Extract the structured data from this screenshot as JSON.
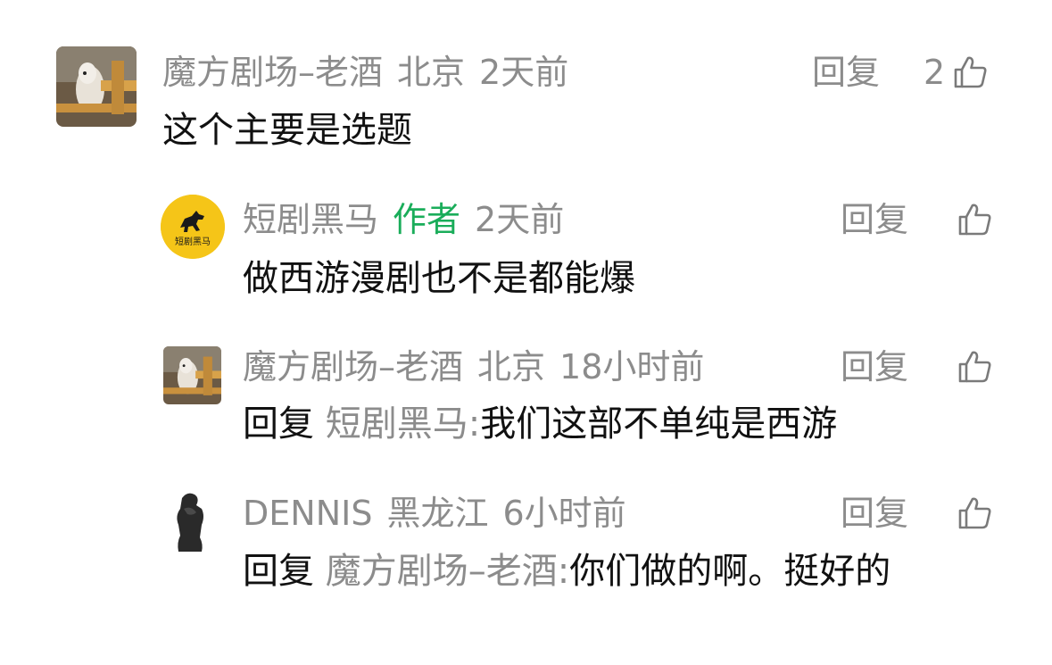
{
  "comments": [
    {
      "username": "魔方剧场–老酒",
      "location": "北京",
      "time": "2天前",
      "text": "这个主要是选题",
      "reply_label": "回复",
      "likes": "2"
    }
  ],
  "replies": [
    {
      "username": "短剧黑马",
      "author_tag": "作者",
      "time": "2天前",
      "text": "做西游漫剧也不是都能爆",
      "reply_label": "回复",
      "avatar_text": "短剧黑马"
    },
    {
      "username": "魔方剧场–老酒",
      "location": "北京",
      "time": "18小时前",
      "reply_word": "回复",
      "reply_target": "短剧黑马:",
      "text": "我们这部不单纯是西游",
      "reply_label": "回复"
    },
    {
      "username": "DENNIS",
      "location": "黑龙江",
      "time": "6小时前",
      "reply_word": "回复",
      "reply_target": "魔方剧场–老酒:",
      "text": "你们做的啊。挺好的",
      "reply_label": "回复"
    }
  ],
  "colors": {
    "meta_gray": "#8c8c8c",
    "author_green": "#1aad5a",
    "body_black": "#111111",
    "avatar_yellow": "#f5c518"
  }
}
